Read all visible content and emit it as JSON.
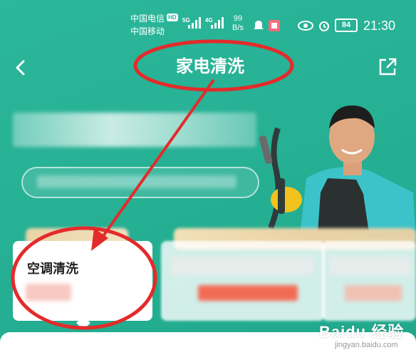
{
  "status_bar": {
    "carrier1": "中国电信",
    "carrier1_badge": "HD",
    "carrier2": "中国移动",
    "net1": "5G",
    "net2": "4G",
    "speed_value": "99",
    "speed_unit": "B/s",
    "battery": "84",
    "time": "21:30"
  },
  "nav": {
    "title": "家电清洗",
    "back_icon": "chevron-left-icon",
    "share_icon": "external-link-icon"
  },
  "cards": [
    {
      "title": "空调清洗"
    }
  ],
  "watermark": {
    "brand": "Baidu 经验",
    "url": "jingyan.baidu.com"
  },
  "colors": {
    "background": "#2bb79a",
    "annotation": "#e32b2b",
    "card": "#ffffff"
  }
}
